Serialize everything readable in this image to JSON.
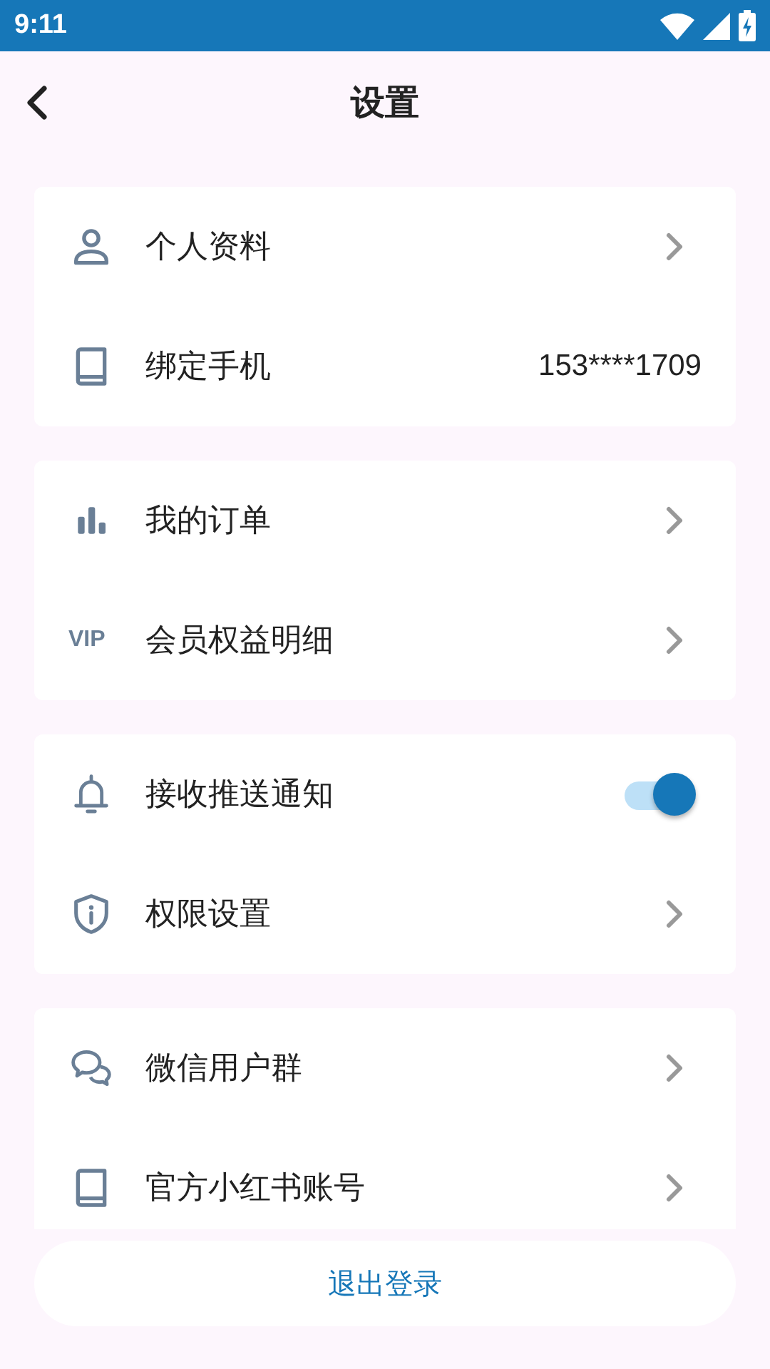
{
  "status_bar": {
    "time": "9:11"
  },
  "header": {
    "title": "设置"
  },
  "groups": [
    {
      "rows": [
        {
          "kind": "link",
          "label": "个人资料"
        },
        {
          "kind": "value",
          "label": "绑定手机",
          "value": "153****1709"
        }
      ]
    },
    {
      "rows": [
        {
          "kind": "link",
          "label": "我的订单"
        },
        {
          "kind": "link",
          "label": "会员权益明细",
          "badge": "VIP"
        }
      ]
    },
    {
      "rows": [
        {
          "kind": "toggle",
          "label": "接收推送通知",
          "on": true
        },
        {
          "kind": "link",
          "label": "权限设置"
        }
      ]
    },
    {
      "rows": [
        {
          "kind": "link",
          "label": "微信用户群"
        },
        {
          "kind": "link",
          "label": "官方小红书账号"
        }
      ]
    }
  ],
  "logout_button": {
    "label": "退出登录"
  }
}
